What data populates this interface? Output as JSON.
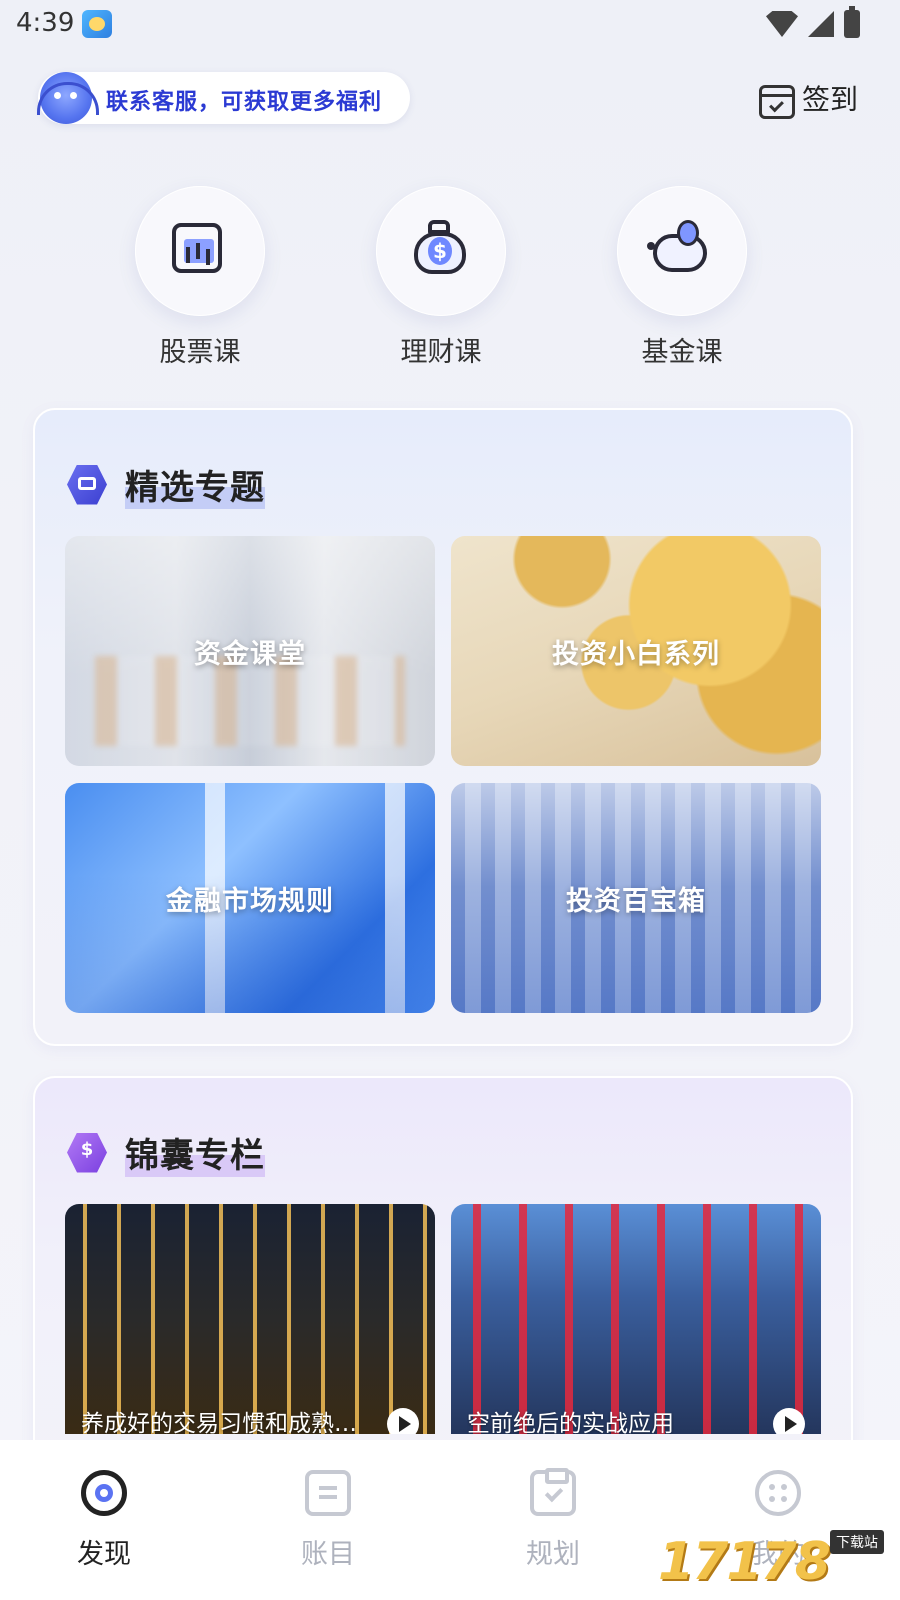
{
  "status_bar": {
    "time": "4:39"
  },
  "header": {
    "contact_text": "联系客服，可获取更多福利",
    "signin_label": "签到"
  },
  "quick_links": [
    {
      "label": "股票课",
      "icon": "stock-chart-icon"
    },
    {
      "label": "理财课",
      "icon": "money-bag-icon"
    },
    {
      "label": "基金课",
      "icon": "piggy-bank-icon"
    }
  ],
  "featured": {
    "title": "精选专题",
    "tiles": [
      {
        "label": "资金课堂"
      },
      {
        "label": "投资小白系列"
      },
      {
        "label": "金融市场规则"
      },
      {
        "label": "投资百宝箱"
      }
    ]
  },
  "column": {
    "title": "锦囊专栏",
    "videos": [
      {
        "caption": "养成好的交易习惯和成熟的..."
      },
      {
        "caption": "空前绝后的实战应用"
      }
    ]
  },
  "tab_bar": {
    "tabs": [
      {
        "label": "发现",
        "icon": "discover-icon",
        "active": true
      },
      {
        "label": "账目",
        "icon": "ledger-icon",
        "active": false
      },
      {
        "label": "规划",
        "icon": "plan-icon",
        "active": false
      },
      {
        "label": "我的",
        "icon": "mine-icon",
        "active": false
      }
    ]
  },
  "watermark": {
    "text": "17178",
    "tag": "下载站"
  },
  "colors": {
    "accent": "#2b3ad3",
    "icon_blue": "#5b73f2",
    "inactive_tab": "#aeb2bd"
  }
}
